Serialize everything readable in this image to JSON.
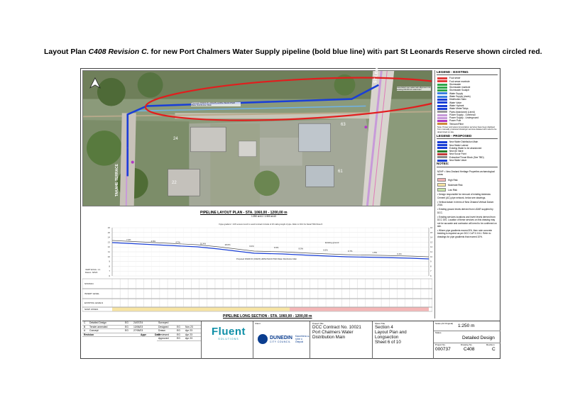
{
  "caption": {
    "lead": "Layout Plan ",
    "italic": "C408 Revision C.",
    "rest": " for new Port Chalmers Water Supply pipeline (bold blue line) with part St Leonards Reserve shown circled red."
  },
  "plan": {
    "street_st_leonards": "ST LEONARDS DRIVE",
    "street_takahe": "TAKAHE TERRACE",
    "lot_24": "24",
    "lot_22": "22",
    "lot_63": "63",
    "lot_61": "61",
    "pipe_note": "Proposed DN200 ID (OD225) HDPE PE100 PN20 Water Distribution Main",
    "reservoir_note": "Associated new watermain alignment into existing DN150 AC watermain",
    "title": "PIPELINE LAYOUT PLAN - STA. 1060,00 - 1200,00 m",
    "scale": "1:250 at A1 / 1:500 at A3",
    "colors": {
      "new_main": "#1a3fd6",
      "reserve_circle": "#e21d1d",
      "existing_road": "#c79ad9"
    }
  },
  "legend": {
    "existing_title": "LEGEND - EXISTING",
    "existing": [
      "Foul sewer",
      "Foul sewer manhole",
      "Stormwater",
      "Stormwater manhole",
      "Stormwater Soakpit",
      "Water Supply",
      "Water Supply (ducts)",
      "Distribution Main",
      "Water Valve",
      "Water Hydrant",
      "Water Meter/Tobys",
      "Pipes Abandoned (Lined)",
      "Power Supply - Overhead",
      "Power Supply - Underground",
      "Power Pole",
      "Telecom/Fibre"
    ],
    "existing_note": "Note: Power and telecommunication services have been digitised from manually produced drawings/ services dataset with need to be determined on site.",
    "proposed_title": "LEGEND - PROPOSED",
    "proposed": [
      "New Water Distribution Main",
      "New Water Lateral",
      "Existing Water to be abandoned",
      "New Air Valve",
      "New Scour Point",
      "Extraction/Thrust Block (See TBD)",
      "New Water Valve"
    ],
    "notes_title": "NOTES:",
    "notes_intro": "NZHP = New Zealand Heritage Properties archaeological areas",
    "risk": [
      {
        "label": "High Risk",
        "color": "#f4b6b6"
      },
      {
        "label": "Moderate Risk",
        "color": "#f7e4a3"
      },
      {
        "label": "Low Risk",
        "color": "#c8e6a9"
      }
    ],
    "notes": [
      "Design responsible for removal of existing Asbestos Cement (AC) pipe network, below see drawings.",
      "Vertical datum in terms of New Zealand Vertical Datum 2016.",
      "Existing ground levels derived from LiDAR supplied by DCC.",
      "Existing services locations and invert levels derived from DCC GIS. Location of these services on this drawing may not be accurate and contractor will need to be confirmed on site.",
      "Where pipe gradients exceed 5%, then note concrete bedding is required as per DCC CoP 3.3.8.1. Refer to drawings for pipe gradients that exceed 10%."
    ]
  },
  "long_section": {
    "title": "PIPELINE LONG SECTION - STA. 1060,00 - 1200,00 m",
    "scale_note": "1:250 at A1 / 1:500 at A3",
    "vert_exag": "VERT EXAG. 1:1",
    "datum": "Datum: NZVD",
    "rows": [
      "STATION",
      "INVERT LEVEL",
      "EXISTING LEVELS",
      "NZHP ZONES"
    ],
    "existing_ground_label": "Existing ground",
    "pipe_label": "Proposed DN200 ID (OD225) HDPE PE100 PN20 Water Distribution Main",
    "callout": "If pipe gradient > 10% ensure trench is sand Contract/ Include of 2% railing length of pipe. Refer to DCC for Detail TD34 Note 8.",
    "y_ticks": [
      "16",
      "15",
      "14",
      "13",
      "12",
      "11",
      "10",
      "9",
      "8",
      "7",
      "6"
    ],
    "grades": [
      "7.6%",
      "4.6%",
      "4.7%",
      "10.4%",
      "28.6%",
      "6.0%",
      "6.5%",
      "8.5%",
      "6.6%",
      "9.7%",
      "1.8%",
      "0.4%"
    ]
  },
  "title_block": {
    "revisions": [
      {
        "rev": "C",
        "desc": "Detailed Design",
        "by": "EG",
        "date": "24/07/24"
      },
      {
        "rev": "B",
        "desc": "Tender amended",
        "by": "EG",
        "date": "13/06/23"
      },
      {
        "rev": "A",
        "desc": "Concept",
        "by": "EG",
        "date": "27/05/23"
      }
    ],
    "rev_headers": [
      "Revision",
      "Appr",
      "Date"
    ],
    "approvals": [
      {
        "role": "Surveyed",
        "by": "",
        "date": ""
      },
      {
        "role": "Designed",
        "by": "EG",
        "date": "Nov 23"
      },
      {
        "role": "Drawn",
        "by": "EG",
        "date": "Apr 23"
      },
      {
        "role": "Reviewed",
        "by": "EG",
        "date": "Apr 23"
      },
      {
        "role": "Approved",
        "by": "EG",
        "date": "Apr 23"
      }
    ],
    "consultant_name": "Fluent",
    "consultant_sub": "SOLUTIONS",
    "client_label": "Client",
    "client_name": "DUNEDIN",
    "client_sub": "CITY COUNCIL",
    "client_maori": "Kaunihera a-rohe o Ōtepoti",
    "project_label": "Project Title",
    "project_lines": [
      "DCC Contract No. 10021",
      "Port Chalmers Water",
      "Distribution Main"
    ],
    "sheet_label": "Sheet Title",
    "sheet_lines": [
      "Section 4",
      "Layout Plan and",
      "Longsection",
      "Sheet 6 of 10"
    ],
    "scale_label": "Scale (A3 Original)",
    "scale_value": "1:250 m",
    "status_label": "Status",
    "status_value": "Detailed Design",
    "project_no_label": "Project No.",
    "project_no": "000737",
    "drawing_label": "Drawing No.",
    "drawing_no": "C408",
    "revision_label": "Revision",
    "revision": "C"
  }
}
